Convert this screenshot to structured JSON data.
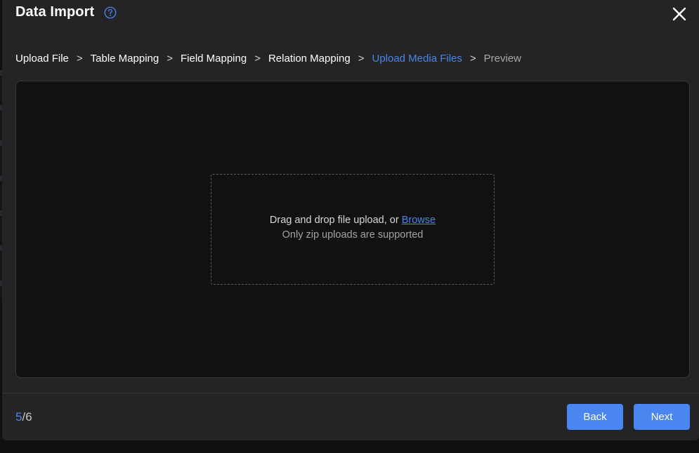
{
  "dialog": {
    "title": "Data Import",
    "help_icon": "help-circle-icon",
    "close_icon": "close-icon"
  },
  "breadcrumb": {
    "steps": [
      {
        "label": "Upload File",
        "state": "done"
      },
      {
        "label": "Table Mapping",
        "state": "done"
      },
      {
        "label": "Field Mapping",
        "state": "done"
      },
      {
        "label": "Relation Mapping",
        "state": "done"
      },
      {
        "label": "Upload Media Files",
        "state": "active"
      },
      {
        "label": "Preview",
        "state": "pending"
      }
    ],
    "separator": ">"
  },
  "dropzone": {
    "prompt": "Drag and drop file upload, or",
    "browse_label": "Browse",
    "hint": "Only zip uploads are supported"
  },
  "footer": {
    "step_current": "5",
    "step_total": "/6",
    "back_label": "Back",
    "next_label": "Next"
  },
  "colors": {
    "accent": "#4a86e8",
    "dialog_bg": "#242426",
    "content_bg": "#111112",
    "button_bg": "#4a86f0"
  }
}
